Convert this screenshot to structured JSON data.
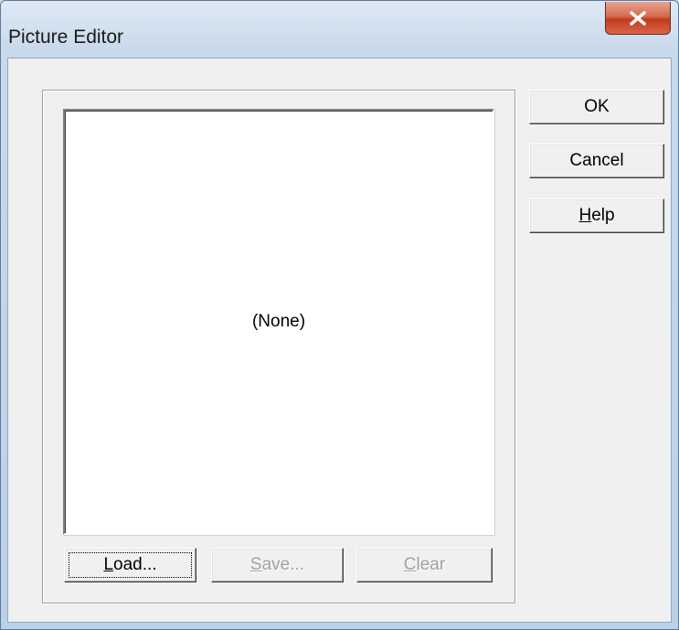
{
  "window": {
    "title": "Picture Editor",
    "close_icon": "close-icon"
  },
  "picture": {
    "content_text": "(None)"
  },
  "buttons": {
    "load": {
      "label_access": "L",
      "label_rest": "oad...",
      "enabled": true,
      "focused": true
    },
    "save": {
      "label_access": "S",
      "label_rest": "ave...",
      "enabled": false
    },
    "clear": {
      "label_access": "C",
      "label_rest": "lear",
      "enabled": false
    },
    "ok": {
      "label": "OK"
    },
    "cancel": {
      "label": "Cancel"
    },
    "help": {
      "label_access": "H",
      "label_rest": "elp"
    }
  },
  "colors": {
    "client_bg": "#f0f0f0",
    "close_button": "#c23c1e",
    "disabled_text": "#a0a0a0"
  }
}
